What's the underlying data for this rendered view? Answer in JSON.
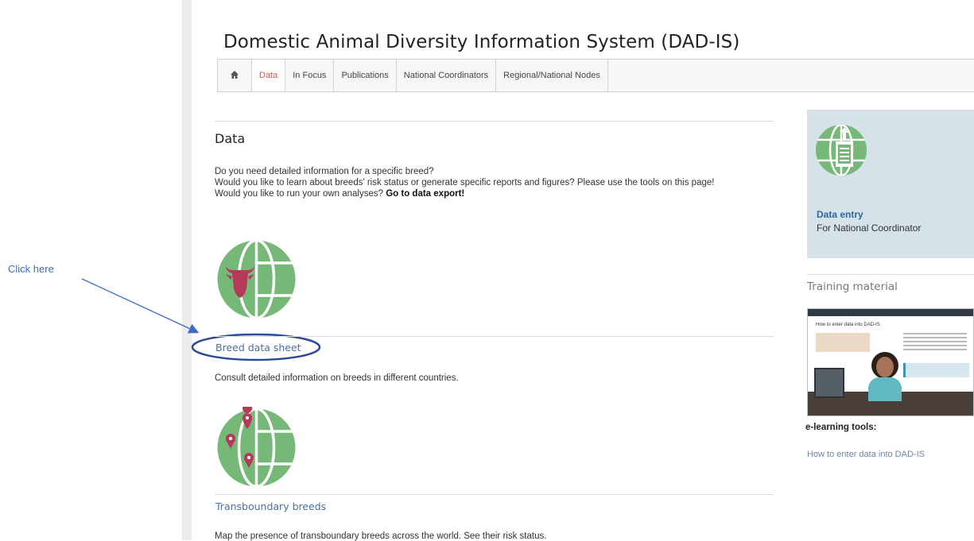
{
  "header": {
    "title": "Domestic Animal Diversity Information System (DAD-IS)"
  },
  "nav": {
    "home_icon": "home-icon",
    "items": [
      "Data",
      "In Focus",
      "Publications",
      "National Coordinators",
      "Regional/National Nodes"
    ],
    "active": "Data"
  },
  "main": {
    "heading": "Data",
    "intro": {
      "line1": "Do you need detailed information for a specific breed?",
      "line2": "Would you like to learn about breeds' risk status or generate specific reports and figures? Please use the tools on this page!",
      "line3_prefix": "Would you like to run your own analyses? ",
      "line3_link": "Go to data export!"
    },
    "sections": [
      {
        "title": "Breed data sheet",
        "desc": "Consult detailed information on breeds in different countries.",
        "icon": "cow-globe-icon"
      },
      {
        "title": "Transboundary breeds",
        "desc": "Map the presence of transboundary breeds across the world. See their risk status.",
        "icon": "map-pin-globe-icon"
      }
    ]
  },
  "sidebar": {
    "data_entry": {
      "label": "Data entry",
      "sub": "For National Coordinator",
      "icon": "data-entry-globe-icon"
    },
    "training_heading": "Training material",
    "thumbnail": {
      "heading": "How to enter data into DAD-IS"
    },
    "elearning_label": "e-learning tools:",
    "elearning_link": "How to enter data into DAD-IS"
  },
  "annotation": {
    "text": "Click here"
  },
  "colors": {
    "icon_green": "#76b877",
    "active_tab": "#d9534f",
    "link_blue": "#4d6fa3",
    "annotation_blue": "#3b6cc8",
    "sidebox_bg": "#d5e2e7"
  }
}
